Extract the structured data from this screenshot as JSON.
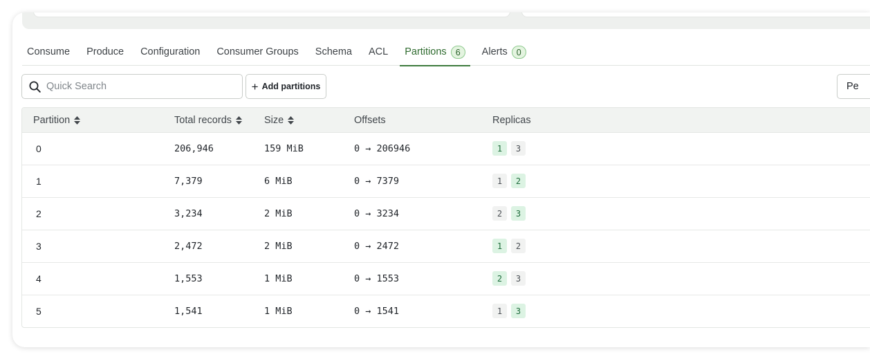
{
  "tabs": [
    {
      "label": "Consume",
      "active": false
    },
    {
      "label": "Produce",
      "active": false
    },
    {
      "label": "Configuration",
      "active": false
    },
    {
      "label": "Consumer Groups",
      "active": false
    },
    {
      "label": "Schema",
      "active": false
    },
    {
      "label": "ACL",
      "active": false
    },
    {
      "label": "Partitions",
      "badge": "6",
      "active": true
    },
    {
      "label": "Alerts",
      "badge": "0",
      "active": false
    }
  ],
  "toolbar": {
    "search_placeholder": "Quick Search",
    "add_partitions_label": "Add partitions",
    "per_page_label": "Pe"
  },
  "table": {
    "columns": [
      {
        "label": "Partition",
        "sortable": true
      },
      {
        "label": "Total records",
        "sortable": true
      },
      {
        "label": "Size",
        "sortable": true
      },
      {
        "label": "Offsets",
        "sortable": false
      },
      {
        "label": "Replicas",
        "sortable": false
      }
    ],
    "rows": [
      {
        "partition": "0",
        "records": "206,946",
        "size": "159 MiB",
        "offsets": "0 → 206946",
        "replicas": [
          {
            "id": "1",
            "leader": true
          },
          {
            "id": "3",
            "leader": false
          }
        ]
      },
      {
        "partition": "1",
        "records": "7,379",
        "size": "6 MiB",
        "offsets": "0 → 7379",
        "replicas": [
          {
            "id": "1",
            "leader": false
          },
          {
            "id": "2",
            "leader": true
          }
        ]
      },
      {
        "partition": "2",
        "records": "3,234",
        "size": "2 MiB",
        "offsets": "0 → 3234",
        "replicas": [
          {
            "id": "2",
            "leader": false
          },
          {
            "id": "3",
            "leader": true
          }
        ]
      },
      {
        "partition": "3",
        "records": "2,472",
        "size": "2 MiB",
        "offsets": "0 → 2472",
        "replicas": [
          {
            "id": "1",
            "leader": true
          },
          {
            "id": "2",
            "leader": false
          }
        ]
      },
      {
        "partition": "4",
        "records": "1,553",
        "size": "1 MiB",
        "offsets": "0 → 1553",
        "replicas": [
          {
            "id": "2",
            "leader": true
          },
          {
            "id": "3",
            "leader": false
          }
        ]
      },
      {
        "partition": "5",
        "records": "1,541",
        "size": "1 MiB",
        "offsets": "0 → 1541",
        "replicas": [
          {
            "id": "1",
            "leader": false
          },
          {
            "id": "3",
            "leader": true
          }
        ]
      }
    ]
  },
  "colors": {
    "accent": "#3c7a3c",
    "leader_bg": "#dcf3e3",
    "follower_bg": "#f1f2f1"
  }
}
